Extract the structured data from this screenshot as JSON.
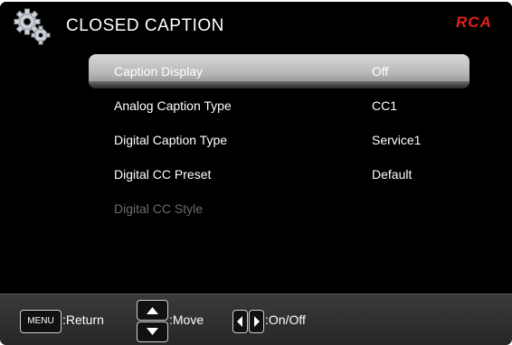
{
  "header": {
    "title": "CLOSED CAPTION",
    "logo": "RCA",
    "icon": "gears-icon"
  },
  "menu": {
    "items": [
      {
        "label": "Caption Display",
        "value": "Off",
        "selected": true,
        "enabled": true
      },
      {
        "label": "Analog Caption Type",
        "value": "CC1",
        "selected": false,
        "enabled": true
      },
      {
        "label": "Digital Caption Type",
        "value": "Service1",
        "selected": false,
        "enabled": true
      },
      {
        "label": "Digital CC Preset",
        "value": "Default",
        "selected": false,
        "enabled": true
      },
      {
        "label": "Digital CC Style",
        "value": "",
        "selected": false,
        "enabled": false
      }
    ]
  },
  "footer": {
    "menu_key": "MENU",
    "return_label": ":Return",
    "move_label": ":Move",
    "onoff_label": ":On/Off"
  },
  "colors": {
    "background": "#000000",
    "logo": "#e0201b",
    "highlight": "#c8c8c8",
    "disabled_text": "#6b6b6b"
  }
}
